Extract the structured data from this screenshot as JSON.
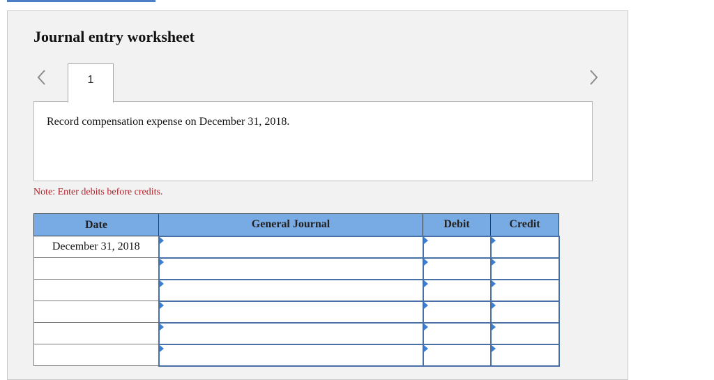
{
  "worksheet": {
    "title": "Journal entry worksheet",
    "current_step": "1",
    "prompt": "Record compensation expense on December 31, 2018.",
    "note": "Note: Enter debits before credits.",
    "nav": {
      "prev_icon": "chevron-left-icon",
      "next_icon": "chevron-right-icon"
    }
  },
  "table": {
    "headers": [
      "Date",
      "General Journal",
      "Debit",
      "Credit"
    ],
    "rows": [
      {
        "date": "December 31, 2018",
        "account": "",
        "debit": "",
        "credit": ""
      },
      {
        "date": "",
        "account": "",
        "debit": "",
        "credit": ""
      },
      {
        "date": "",
        "account": "",
        "debit": "",
        "credit": ""
      },
      {
        "date": "",
        "account": "",
        "debit": "",
        "credit": ""
      },
      {
        "date": "",
        "account": "",
        "debit": "",
        "credit": ""
      },
      {
        "date": "",
        "account": "",
        "debit": "",
        "credit": ""
      }
    ]
  },
  "colors": {
    "header_bg": "#78abe4",
    "input_border": "#4670a6",
    "note_text": "#b0202a",
    "panel_bg": "#f2f2f2"
  }
}
